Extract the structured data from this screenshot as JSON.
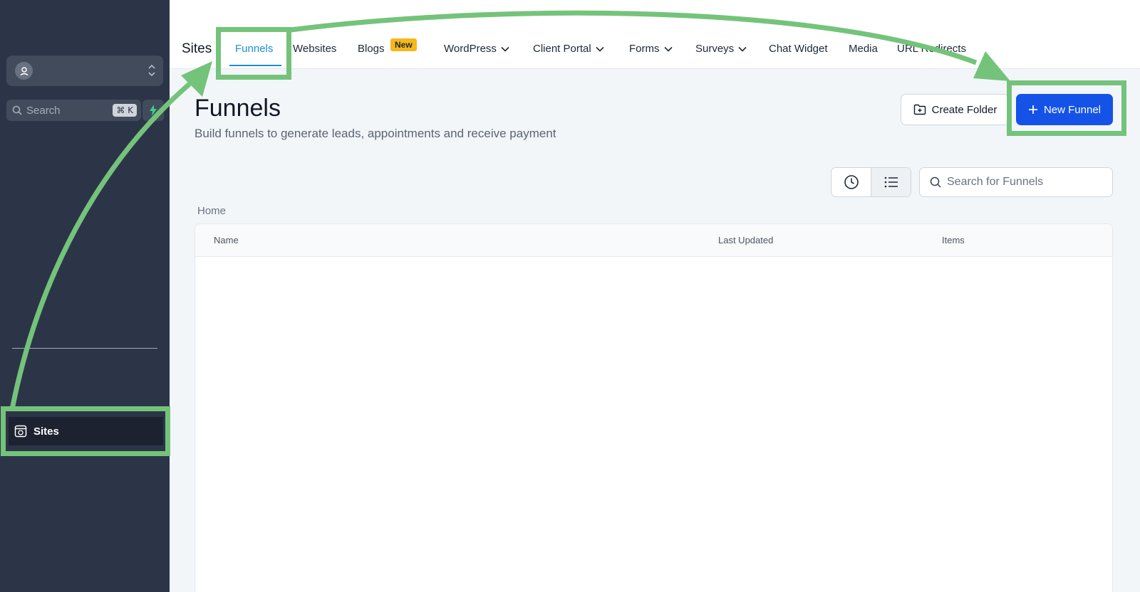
{
  "sidebar": {
    "search_label": "Search",
    "search_shortcut": "⌘ K",
    "nav_sites_label": "Sites"
  },
  "topbar": {
    "title": "Sites",
    "tabs": [
      {
        "label": "Funnels",
        "active": true
      },
      {
        "label": "Websites"
      },
      {
        "label": "Blogs",
        "badge": "New"
      },
      {
        "label": "WordPress",
        "dropdown": true
      },
      {
        "label": "Client Portal",
        "dropdown": true
      },
      {
        "label": "Forms",
        "dropdown": true
      },
      {
        "label": "Surveys",
        "dropdown": true
      },
      {
        "label": "Chat Widget"
      },
      {
        "label": "Media"
      },
      {
        "label": "URL Redirects"
      }
    ]
  },
  "main": {
    "title": "Funnels",
    "subtitle": "Build funnels to generate leads, appointments and receive payment",
    "create_folder_label": "Create Folder",
    "new_funnel_label": "New Funnel",
    "search_placeholder": "Search for Funnels",
    "breadcrumb": "Home",
    "table_headers": [
      "Name",
      "Last Updated",
      "Items"
    ]
  },
  "colors": {
    "sidebar_bg": "#2c3548",
    "accent": "#1d8fd6",
    "primary_button": "#1553e8",
    "badge": "#f6b71a",
    "annotation": "#74c37a"
  }
}
